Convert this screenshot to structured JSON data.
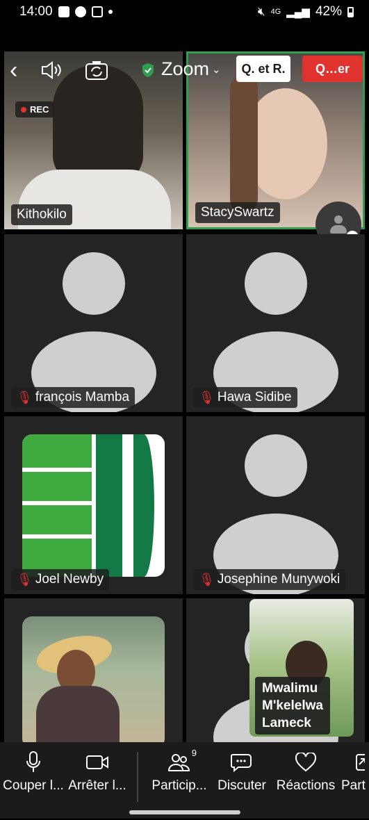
{
  "status_bar": {
    "time": "14:00",
    "battery": "42%",
    "network": "4G"
  },
  "meeting": {
    "app_name": "Zoom",
    "qa_label": "Q. et R.",
    "leave_label": "Q…er",
    "rec_label": "REC"
  },
  "participants": [
    {
      "name": "Kithokilo",
      "muted": false
    },
    {
      "name": "StacySwartz",
      "muted": false
    },
    {
      "name": "françois Mamba",
      "muted": true
    },
    {
      "name": "Hawa Sidibe",
      "muted": true
    },
    {
      "name": "Joel Newby",
      "muted": true
    },
    {
      "name": "Josephine Munywoki",
      "muted": true
    },
    {
      "name": "",
      "muted": false
    },
    {
      "name": "",
      "muted": false
    }
  ],
  "pinned_overlay": {
    "line1": "Mwalimu",
    "line2": "M'kelelwa",
    "line3": "Lameck"
  },
  "toolbar": {
    "mute": "Couper l...",
    "video": "Arrêter l...",
    "participants": "Particip...",
    "participants_count": "9",
    "chat": "Discuter",
    "reactions": "Réactions",
    "share": "Part"
  },
  "colors": {
    "accent_green": "#2e9e4f",
    "leave_red": "#e0322f",
    "tile_bg": "#242424"
  }
}
